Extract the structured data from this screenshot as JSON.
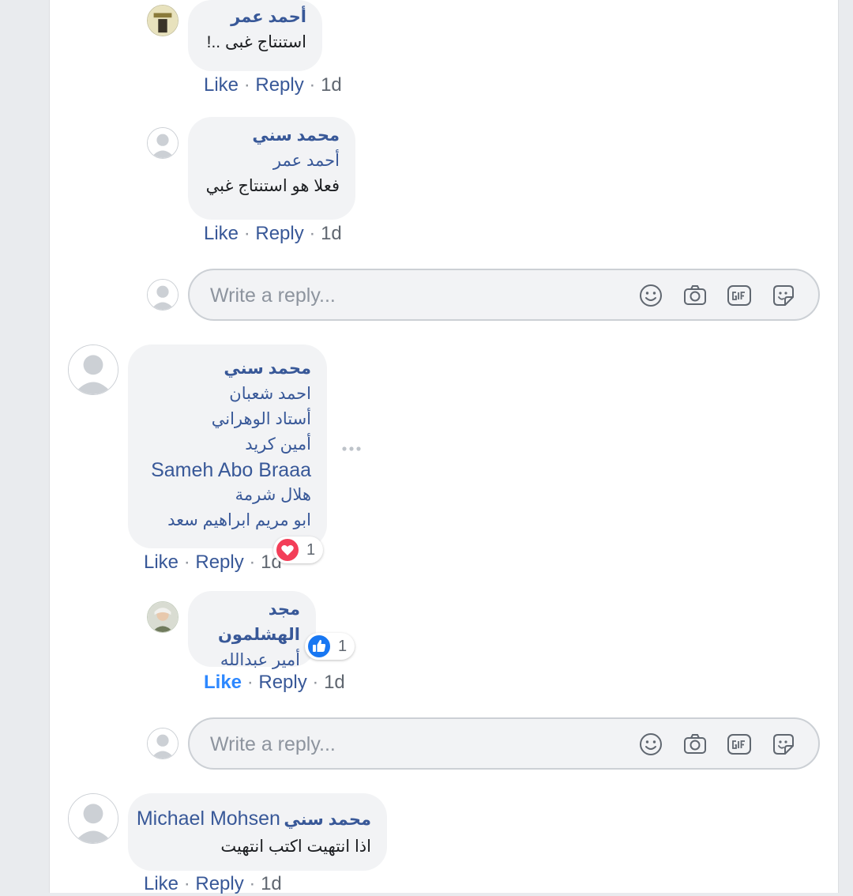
{
  "colors": {
    "link": "#385898",
    "like_active": "#2d88ff",
    "bubble_bg": "#f2f3f5",
    "love_red": "#f33e58",
    "like_blue": "#1877f2"
  },
  "comments": [
    {
      "author": "أحمد عمر",
      "text": "استنتاج غبى ..!"
    },
    {
      "author": "محمد سني",
      "mention": "أحمد عمر",
      "text": "فعلا هو استنتاج غبي"
    },
    {
      "author": "محمد سني",
      "mentions": [
        "احمد شعبان",
        "أستاد الوهراني",
        "أمين كريد",
        "Sameh Abo Braaa",
        "هلال شرمة",
        "ابو مريم ابراهيم سعد"
      ],
      "reaction": {
        "icon": "heart-icon",
        "count": "1"
      }
    },
    {
      "author": "مجد الهشلمون",
      "mention": "أمير عبدالله",
      "reaction": {
        "icon": "thumbs-up-icon",
        "count": "1"
      }
    },
    {
      "author": "محمد سني",
      "mention": "Michael Mohsen",
      "text": "اذا انتهيت اكتب انتهيت"
    }
  ],
  "actions": {
    "like": "Like",
    "reply": "Reply",
    "sep": "·",
    "time": "1d"
  },
  "reply_box": {
    "placeholder": "Write a reply..."
  },
  "reply_icons": [
    "smiley-icon",
    "camera-icon",
    "gif-icon",
    "sticker-icon"
  ]
}
